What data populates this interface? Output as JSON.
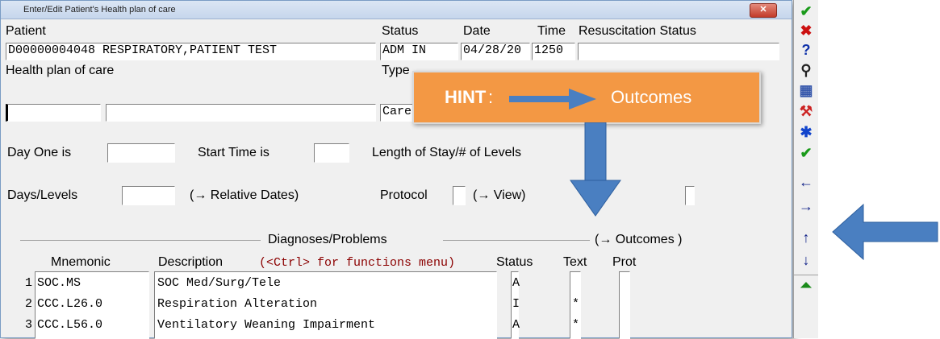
{
  "window": {
    "title": "Enter/Edit Patient's Health plan of care",
    "close": "✕"
  },
  "labels": {
    "patient": "Patient",
    "status": "Status",
    "date": "Date",
    "time": "Time",
    "resuscitation": "Resuscitation Status",
    "health_plan": "Health plan of care",
    "type": "Type",
    "day_one": "Day One is",
    "start_time": "Start Time is",
    "length_stay": "Length of Stay/# of Levels",
    "days_levels": "Days/Levels",
    "relative_dates": "(→ Relative Dates)",
    "protocol": "Protocol",
    "view": "(→ View)",
    "diagnoses": "Diagnoses/Problems",
    "outcomes": "(→ Outcomes )",
    "mnemonic": "Mnemonic",
    "description": "Description",
    "ctrl_hint": "(<Ctrl> for functions menu)",
    "status_col": "Status",
    "text_col": "Text",
    "prot_col": "Prot"
  },
  "fields": {
    "patient": "D00000004048 RESPIRATORY,PATIENT TEST",
    "status": "ADM IN",
    "date": "04/28/20",
    "time": "1250",
    "type": "Care"
  },
  "hint": {
    "bold": "HINT",
    "colon": ":",
    "target": "Outcomes"
  },
  "rows": [
    {
      "num": "1",
      "mnemonic": "SOC.MS",
      "description": "SOC Med/Surg/Tele",
      "status": "A",
      "text": ""
    },
    {
      "num": "2",
      "mnemonic": "CCC.L26.0",
      "description": "Respiration Alteration",
      "status": "I",
      "text": "*"
    },
    {
      "num": "3",
      "mnemonic": "CCC.L56.0",
      "description": "Ventilatory Weaning Impairment",
      "status": "A",
      "text": "*"
    }
  ],
  "toolbar": [
    {
      "name": "ok-check-icon",
      "glyph": "✔",
      "color": "#1a9a1a"
    },
    {
      "name": "cancel-x-icon",
      "glyph": "✖",
      "color": "#cc1111"
    },
    {
      "name": "help-icon",
      "glyph": "?",
      "color": "#1133aa"
    },
    {
      "name": "binoculars-icon",
      "glyph": "⚲",
      "color": "#222222"
    },
    {
      "name": "grid-delete-icon",
      "glyph": "▦",
      "color": "#3355aa"
    },
    {
      "name": "tools-icon",
      "glyph": "⚒",
      "color": "#cc2222"
    },
    {
      "name": "asterisk-icon",
      "glyph": "✱",
      "color": "#1144cc"
    },
    {
      "name": "check-all-icon",
      "glyph": "✔",
      "color": "#1a9a1a"
    },
    {
      "name": "arrow-left-icon",
      "glyph": "←",
      "color": "#112288"
    },
    {
      "name": "arrow-right-icon",
      "glyph": "→",
      "color": "#112288"
    },
    {
      "name": "arrow-up-icon",
      "glyph": "↑",
      "color": "#112288"
    },
    {
      "name": "arrow-down-icon",
      "glyph": "↓",
      "color": "#112288"
    },
    {
      "name": "page-up-icon",
      "glyph": "⏶",
      "color": "#1a8a1a"
    }
  ],
  "colors": {
    "hint_bg": "#f39844",
    "arrow_blue": "#4a7fc1",
    "menu_hint": "#8b0000"
  }
}
